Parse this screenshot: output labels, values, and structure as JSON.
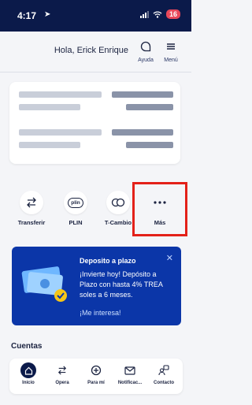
{
  "status_bar": {
    "time": "4:17",
    "battery": "16"
  },
  "header": {
    "greeting": "Hola, Erick Enrique",
    "help_label": "Ayuda",
    "menu_label": "Menú"
  },
  "quick_actions": [
    {
      "label": "Transferir",
      "icon": "transfer-icon"
    },
    {
      "label": "PLIN",
      "icon": "plin-icon",
      "icon_text": "plin"
    },
    {
      "label": "T-Cambio",
      "icon": "exchange-icon"
    },
    {
      "label": "Más",
      "icon": "more-icon"
    }
  ],
  "promo": {
    "title": "Deposito a plazo",
    "body": "¡Invierte hoy! Depósito a Plazo con hasta 4% TREA soles a 6 meses.",
    "cta": "¡Me interesa!"
  },
  "section": {
    "title": "Cuentas"
  },
  "tab_bar": [
    {
      "label": "Inicio",
      "icon": "home-icon",
      "active": true
    },
    {
      "label": "Opera",
      "icon": "transfer-icon"
    },
    {
      "label": "Para mí",
      "icon": "plus-circle-icon"
    },
    {
      "label": "Notificac...",
      "icon": "mail-icon"
    },
    {
      "label": "Contacto",
      "icon": "contact-icon"
    }
  ],
  "colors": {
    "navy": "#0b1a4a",
    "promo_blue": "#0b36a8",
    "highlight_red": "#e32119",
    "background": "#f4f5f8"
  }
}
